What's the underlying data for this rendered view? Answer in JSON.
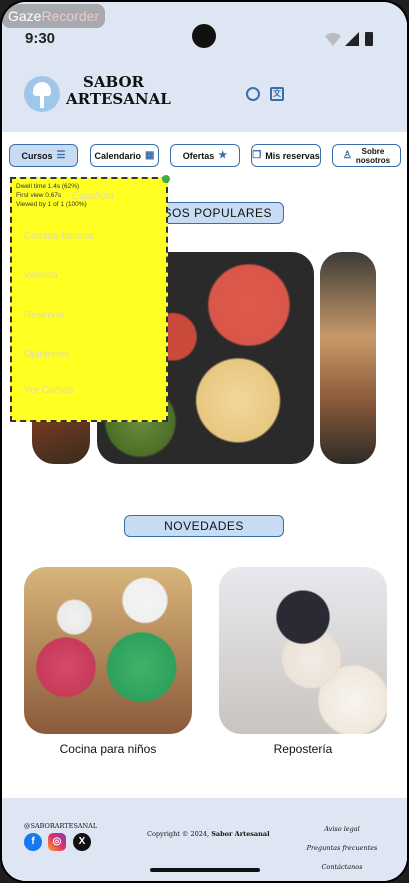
{
  "status_bar": {
    "time": "9:30"
  },
  "recorder_badge": {
    "part1": "Gaze",
    "part2": "Recorder"
  },
  "header": {
    "brand_line1": "SABOR",
    "brand_line2": "ARTESANAL"
  },
  "nav": {
    "items": [
      {
        "label": "Cursos",
        "icon": "menu-icon"
      },
      {
        "label": "Calendario",
        "icon": "calendar-icon"
      },
      {
        "label": "Ofertas",
        "icon": "star-icon"
      },
      {
        "label": "Mis reservas",
        "icon": "bookmark-icon"
      },
      {
        "label_line1": "Sobre",
        "label_line2": "nosotros",
        "icon": "user-icon"
      }
    ]
  },
  "popup": {
    "dwell": "Dwell time 1.4s (62%)",
    "first_view": "First view 0.67s",
    "viewed_by": "Viewed by 1 of 1 (100%)",
    "items": [
      "Española",
      "Comida Italiana",
      "Variada",
      "Reservar",
      "Opiniones",
      "Ver Cursos"
    ]
  },
  "sections": {
    "popular": "CURSOS POPULARES",
    "news": "NOVEDADES"
  },
  "cards": [
    {
      "label": "Cocina para niños"
    },
    {
      "label": "Repostería"
    }
  ],
  "footer": {
    "handle": "@SABORARTESANAL",
    "copyright": "Copyright © 2024,",
    "copyright_brand": "Sabor Artesanal",
    "links": [
      "Aviso legal",
      "Preguntas frecuentes",
      "Contáctanos"
    ]
  }
}
